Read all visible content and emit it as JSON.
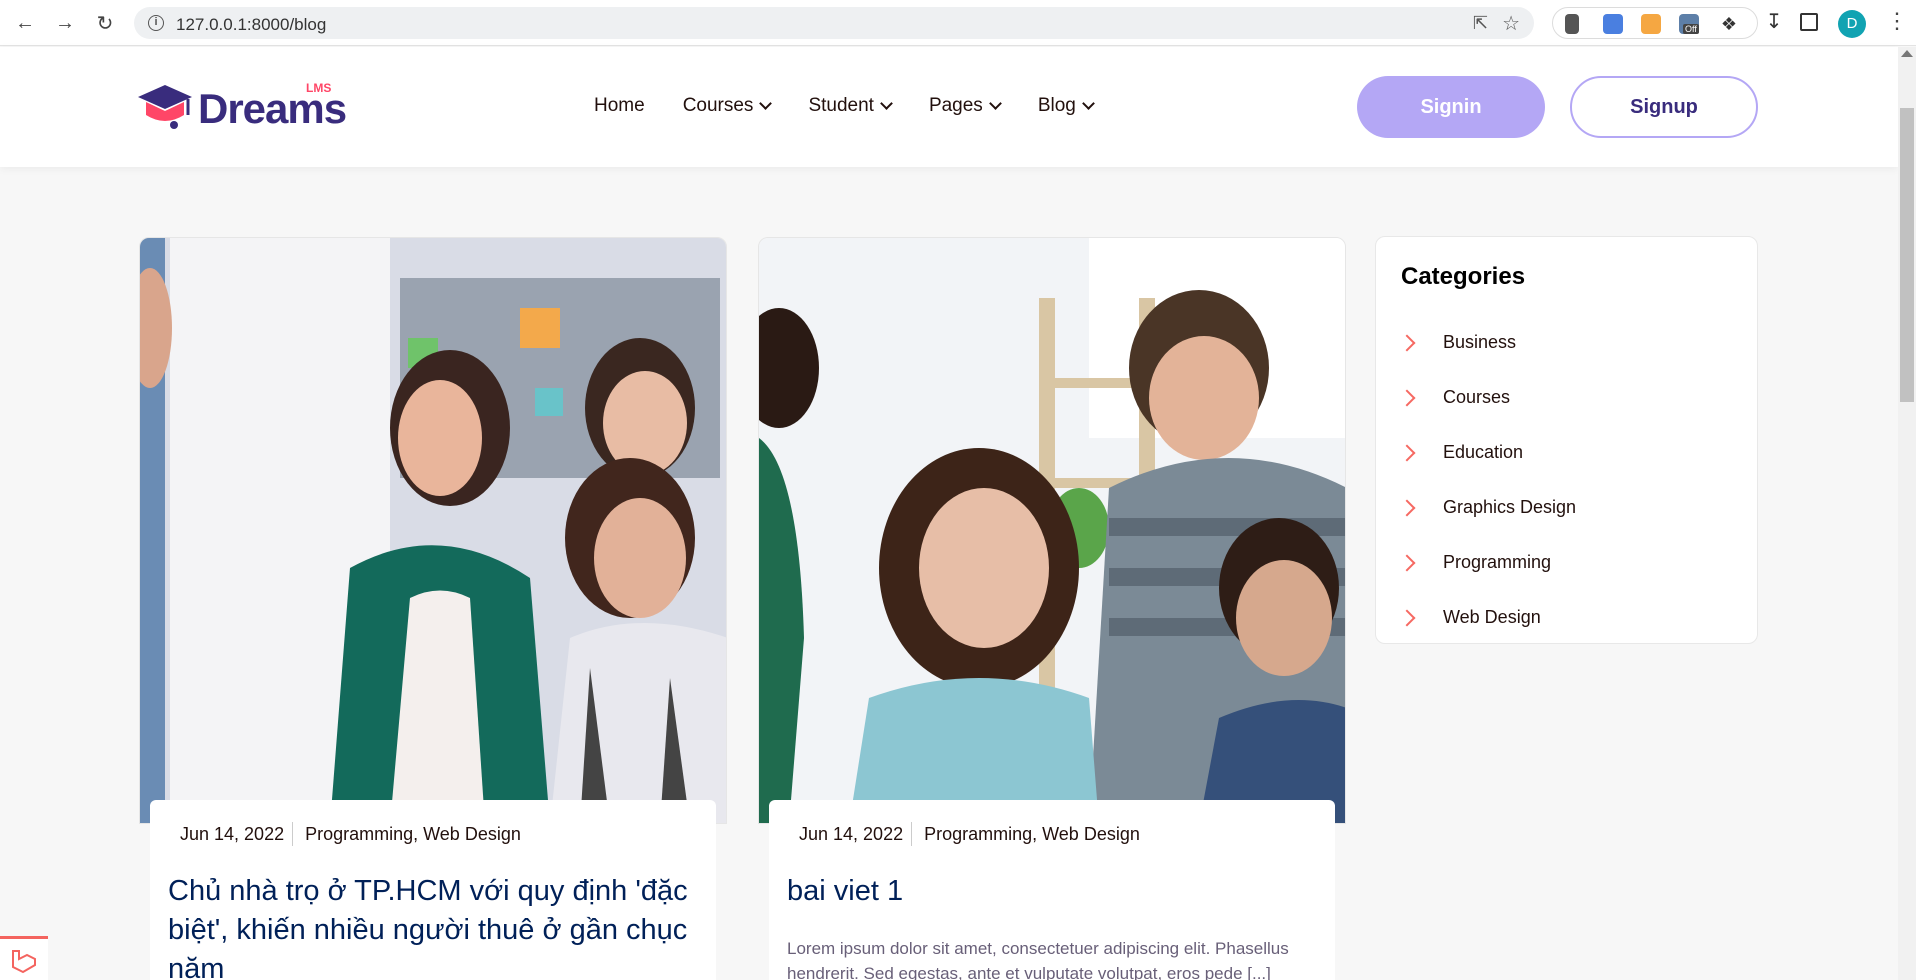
{
  "browser": {
    "url": "127.0.0.1:8000/blog",
    "avatar_letter": "D",
    "ext_badge": "Off"
  },
  "site": {
    "logo_text": "Dreams",
    "logo_sup": "LMS",
    "nav": [
      {
        "label": "Home",
        "dropdown": false
      },
      {
        "label": "Courses",
        "dropdown": true
      },
      {
        "label": "Student",
        "dropdown": true
      },
      {
        "label": "Pages",
        "dropdown": true
      },
      {
        "label": "Blog",
        "dropdown": true
      }
    ],
    "signin_label": "Signin",
    "signup_label": "Signup"
  },
  "posts": [
    {
      "date": "Jun 14, 2022",
      "categories": "Programming, Web Design",
      "title": "Chủ nhà trọ ở TP.HCM với quy định 'đặc biệt', khiến nhiều người thuê ở gần chục năm",
      "excerpt": ""
    },
    {
      "date": "Jun 14, 2022",
      "categories": "Programming, Web Design",
      "title": "bai viet 1",
      "excerpt": "Lorem ipsum dolor sit amet, consectetuer adipiscing elit. Phasellus hendrerit. Sed egestas, ante et vulputate volutpat, eros pede [...]"
    }
  ],
  "sidebar": {
    "title": "Categories",
    "categories": [
      "Business",
      "Courses",
      "Education",
      "Graphics Design",
      "Programming",
      "Web Design"
    ]
  },
  "colors": {
    "brand": "#392c7d",
    "accent_pink": "#ff4667",
    "signin_bg": "#b4a7f5",
    "arrow": "#f66962"
  }
}
